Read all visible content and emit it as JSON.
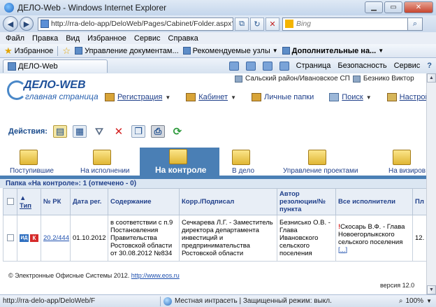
{
  "window": {
    "title": "ДЕЛО-Web - Windows Internet Explorer"
  },
  "address": {
    "url": "http://rra-delo-app/DeloWeb/Pages/Cabinet/Folder.aspx?cabinet_id",
    "search_placeholder": "Bing"
  },
  "menu": [
    "Файл",
    "Правка",
    "Вид",
    "Избранное",
    "Сервис",
    "Справка"
  ],
  "favorites": {
    "label": "Избранное",
    "items": [
      "Управление документам...",
      "Рекомендуемые узлы",
      "Дополнительные на..."
    ]
  },
  "tab": {
    "label": "ДЕЛО-Web"
  },
  "command_bar": {
    "page": "Страница",
    "security": "Безопасность",
    "tools": "Сервис"
  },
  "app": {
    "logo_name": "ДЕЛО-WEB",
    "logo_sub": "главная страница",
    "user_info": "Сальский район/Ивановское СП",
    "user_name": "Безнико Виктор",
    "nav": {
      "registration": "Регистрация",
      "cabinet": "Кабинет",
      "personal_folders": "Личные папки",
      "search": "Поиск",
      "settings": "Настройка"
    },
    "actions_label": "Действия:",
    "folders": {
      "incoming": "Поступившие",
      "in_execution": "На исполнении",
      "on_control": "На контроле",
      "to_case": "В дело",
      "projects": "Управление проектами",
      "for_approval": "На визиров"
    },
    "folder_title": "Папка «На контроле»: 1 (отмечено - 0)",
    "table": {
      "headers": {
        "type": "Тип",
        "rk_num": "№ РК",
        "reg_date": "Дата рег.",
        "content": "Содержание",
        "corr": "Корр./Подписал",
        "author": "Автор резолюции/№ пункта",
        "executors": "Все исполнители",
        "plan": "Пл"
      },
      "row": {
        "badge_blue": "ИД",
        "badge_red": "К",
        "rk_num": "20.2/444",
        "reg_date": "01.10.2012",
        "content": "в соответствии с п.9 Постановления Правительства Ростовской области от 30.08.2012 №834",
        "corr": "Сечкарева Л.Г. - Заместитель директора департамента инвестиций и предпринимательства Ростовской области",
        "author": "Безнисько О.В. - Глава Ивановского сельского поселения",
        "executors_mark": "!",
        "executors": "Скосарь В.Ф. - Глава Новоегорлыкского сельского поселения",
        "executors_more": "[...]",
        "plan": "12."
      }
    },
    "copyright_text": "© Электронные Офисные Системы 2012.",
    "copyright_link": "http://www.eos.ru",
    "version": "версия 12.0"
  },
  "status": {
    "url": "http://rra-delo-app/DeloWeb/F",
    "zone": "Местная интрасеть | Защищенный режим: выкл.",
    "zoom": "100%"
  }
}
